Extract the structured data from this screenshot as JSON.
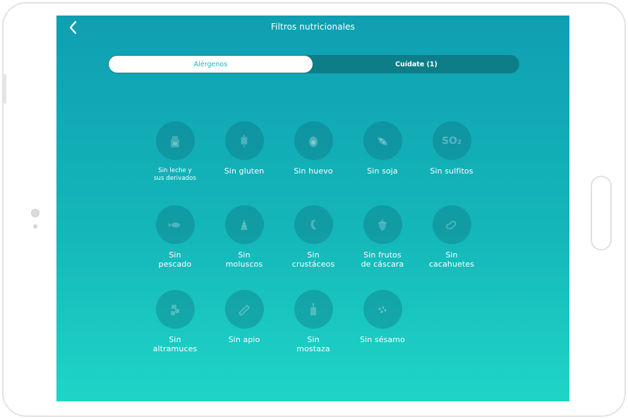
{
  "header": {
    "title": "Filtros nutricionales",
    "back_icon": "chevron-left-icon"
  },
  "tabs": [
    {
      "label": "Alérgenos",
      "active": true
    },
    {
      "label": "Cuídate (1)",
      "active": false
    }
  ],
  "colors": {
    "gradient_top": "#0f9fb2",
    "gradient_bottom": "#1fd5c7",
    "active_tab_text": "#17b8b8",
    "segment_bg": "#0d7d88"
  },
  "filters": [
    {
      "label": "Sin leche y\nsus derivados",
      "icon": "milk-carton-icon"
    },
    {
      "label": "Sin gluten",
      "icon": "wheat-icon"
    },
    {
      "label": "Sin huevo",
      "icon": "egg-icon"
    },
    {
      "label": "Sin soja",
      "icon": "soy-bean-icon"
    },
    {
      "label": "Sin sulfitos",
      "icon": "so2-icon",
      "icon_text": "SO₂"
    },
    {
      "label": "Sin\npescado",
      "icon": "fish-icon"
    },
    {
      "label": "Sin\nmoluscos",
      "icon": "shell-icon"
    },
    {
      "label": "Sin\ncrustáceos",
      "icon": "shrimp-icon"
    },
    {
      "label": "Sin frutos\nde cáscara",
      "icon": "acorn-icon"
    },
    {
      "label": "Sin\ncacahuetes",
      "icon": "peanut-icon"
    },
    {
      "label": "Sin\naltramuces",
      "icon": "lupin-icon"
    },
    {
      "label": "Sin apio",
      "icon": "celery-icon"
    },
    {
      "label": "Sin\nmostaza",
      "icon": "mustard-bottle-icon"
    },
    {
      "label": "Sin sésamo",
      "icon": "sesame-icon"
    }
  ]
}
